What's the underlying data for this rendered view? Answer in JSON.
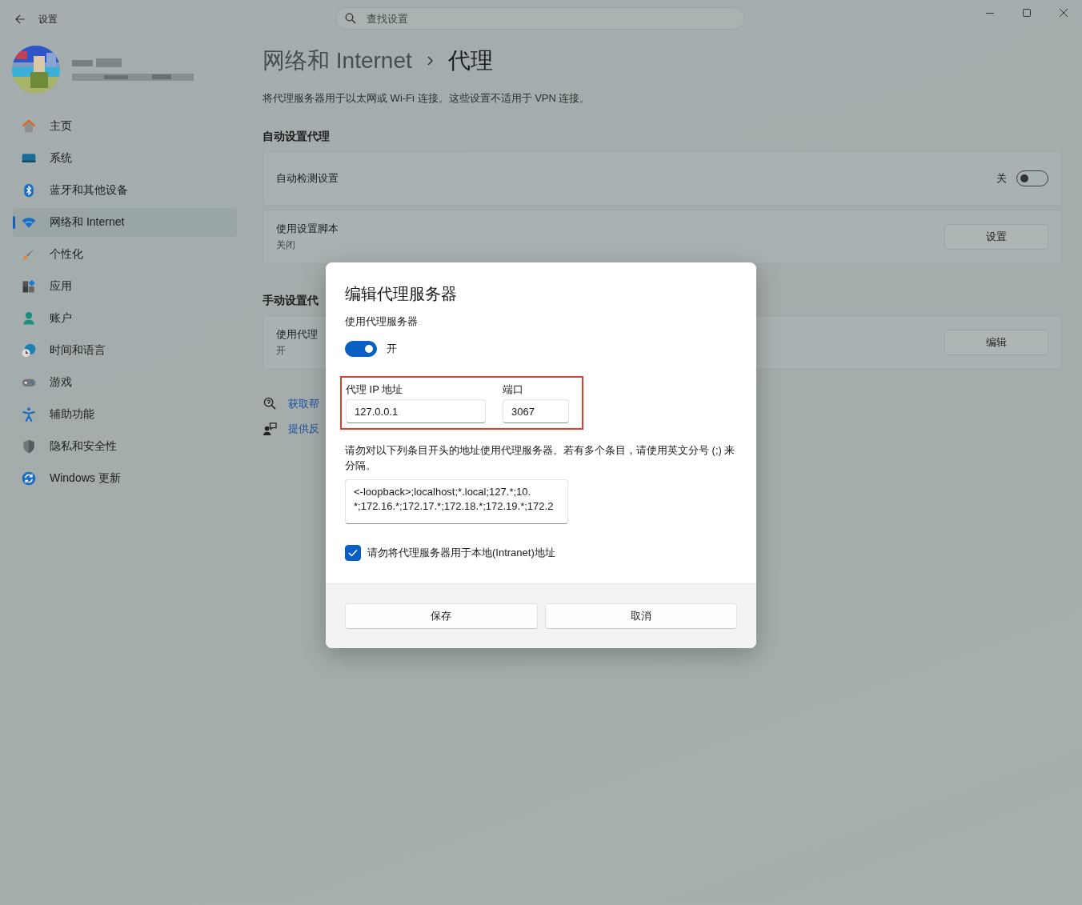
{
  "window": {
    "title": "设置"
  },
  "search": {
    "placeholder": "查找设置"
  },
  "sidebar": {
    "items": [
      {
        "kind": "home",
        "label": "主页",
        "selected": false
      },
      {
        "kind": "system",
        "label": "系统",
        "selected": false
      },
      {
        "kind": "bluetooth",
        "label": "蓝牙和其他设备",
        "selected": false
      },
      {
        "kind": "network",
        "label": "网络和 Internet",
        "selected": true
      },
      {
        "kind": "personalization",
        "label": "个性化",
        "selected": false
      },
      {
        "kind": "apps",
        "label": "应用",
        "selected": false
      },
      {
        "kind": "accounts",
        "label": "账户",
        "selected": false
      },
      {
        "kind": "time",
        "label": "时间和语言",
        "selected": false
      },
      {
        "kind": "gaming",
        "label": "游戏",
        "selected": false
      },
      {
        "kind": "accessibility",
        "label": "辅助功能",
        "selected": false
      },
      {
        "kind": "privacy",
        "label": "隐私和安全性",
        "selected": false
      },
      {
        "kind": "update",
        "label": "Windows 更新",
        "selected": false
      }
    ]
  },
  "header": {
    "breadcrumb": [
      "网络和 Internet",
      "代理"
    ],
    "description": "将代理服务器用于以太网或 Wi-Fi 连接。这些设置不适用于 VPN 连接。"
  },
  "sections": [
    {
      "heading": "自动设置代理",
      "cards": [
        {
          "kind": "toggle",
          "title": "自动检测设置",
          "state_label": "关",
          "on": false
        },
        {
          "kind": "button",
          "title": "使用设置脚本",
          "subtitle": "关闭",
          "button": "设置"
        }
      ]
    },
    {
      "heading": "手动设置代",
      "cards": [
        {
          "kind": "button",
          "title": "使用代理",
          "subtitle": "开",
          "button": "编辑"
        }
      ]
    }
  ],
  "links": [
    {
      "kind": "help",
      "label": "获取帮"
    },
    {
      "kind": "feedback",
      "label": "提供反"
    }
  ],
  "dialog": {
    "title": "编辑代理服务器",
    "toggle": {
      "label": "使用代理服务器",
      "state_label": "开",
      "on": true
    },
    "highlighted": true,
    "address": {
      "label": "代理 IP 地址",
      "value": "127.0.0.1"
    },
    "port": {
      "label": "端口",
      "value": "3067"
    },
    "exceptions": {
      "description": "请勿对以下列条目开头的地址使用代理服务器。若有多个条目，请使用英文分号 (;) 来分隔。",
      "lines": [
        "<-loopback>;localhost;*.local;127.*;10.",
        "*;172.16.*;172.17.*;172.18.*;172.19.*;172.2"
      ]
    },
    "checkbox": {
      "label": "请勿将代理服务器用于本地(Intranet)地址",
      "checked": true
    },
    "buttons": [
      "保存",
      "取消"
    ]
  }
}
